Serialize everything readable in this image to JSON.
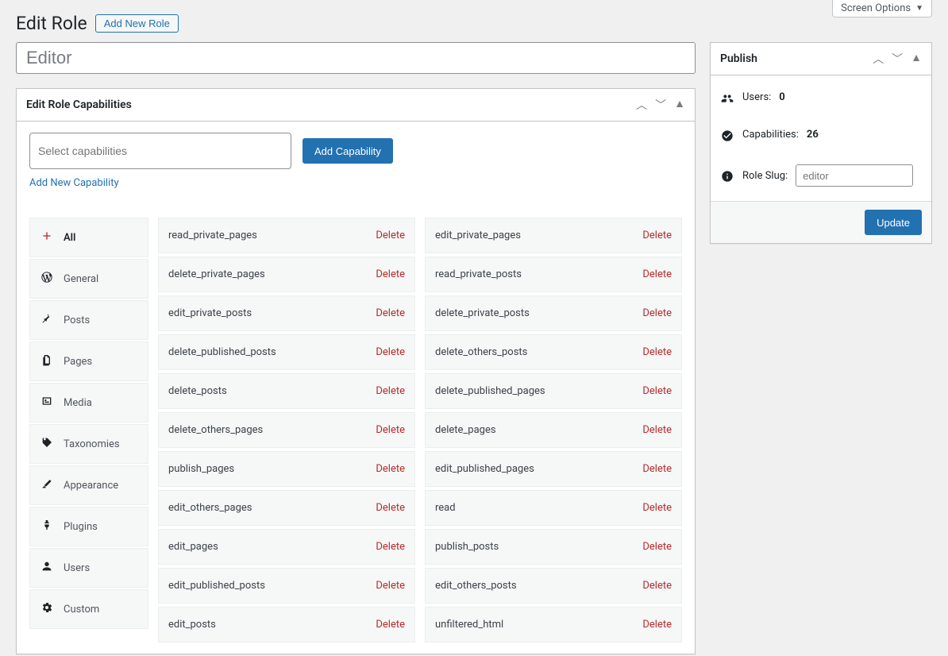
{
  "screen_options": {
    "label": "Screen Options"
  },
  "header": {
    "title": "Edit Role",
    "add_button": "Add New Role"
  },
  "role_name": {
    "value": "Editor"
  },
  "caps_box": {
    "title": "Edit Role Capabilities",
    "select_placeholder": "Select capabilities",
    "add_capability_button": "Add Capability",
    "add_new_capability_link": "Add New Capability",
    "delete_label": "Delete"
  },
  "tabs": [
    {
      "icon": "plus",
      "label": "All",
      "active": true
    },
    {
      "icon": "wp",
      "label": "General",
      "active": false
    },
    {
      "icon": "pin",
      "label": "Posts",
      "active": false
    },
    {
      "icon": "pages",
      "label": "Pages",
      "active": false
    },
    {
      "icon": "media",
      "label": "Media",
      "active": false
    },
    {
      "icon": "tag",
      "label": "Taxonomies",
      "active": false
    },
    {
      "icon": "brush",
      "label": "Appearance",
      "active": false
    },
    {
      "icon": "plug",
      "label": "Plugins",
      "active": false
    },
    {
      "icon": "user",
      "label": "Users",
      "active": false
    },
    {
      "icon": "gear",
      "label": "Custom",
      "active": false
    }
  ],
  "cap_col1": [
    "read_private_pages",
    "delete_private_pages",
    "edit_private_posts",
    "delete_published_posts",
    "delete_posts",
    "delete_others_pages",
    "publish_pages",
    "edit_others_pages",
    "edit_pages",
    "edit_published_posts",
    "edit_posts"
  ],
  "cap_col2": [
    "edit_private_pages",
    "read_private_posts",
    "delete_private_posts",
    "delete_others_posts",
    "delete_published_pages",
    "delete_pages",
    "edit_published_pages",
    "read",
    "publish_posts",
    "edit_others_posts",
    "unfiltered_html"
  ],
  "publish": {
    "title": "Publish",
    "users_label": "Users:",
    "users_value": "0",
    "caps_label": "Capabilities:",
    "caps_value": "26",
    "slug_label": "Role Slug:",
    "slug_placeholder": "editor",
    "update_button": "Update"
  }
}
